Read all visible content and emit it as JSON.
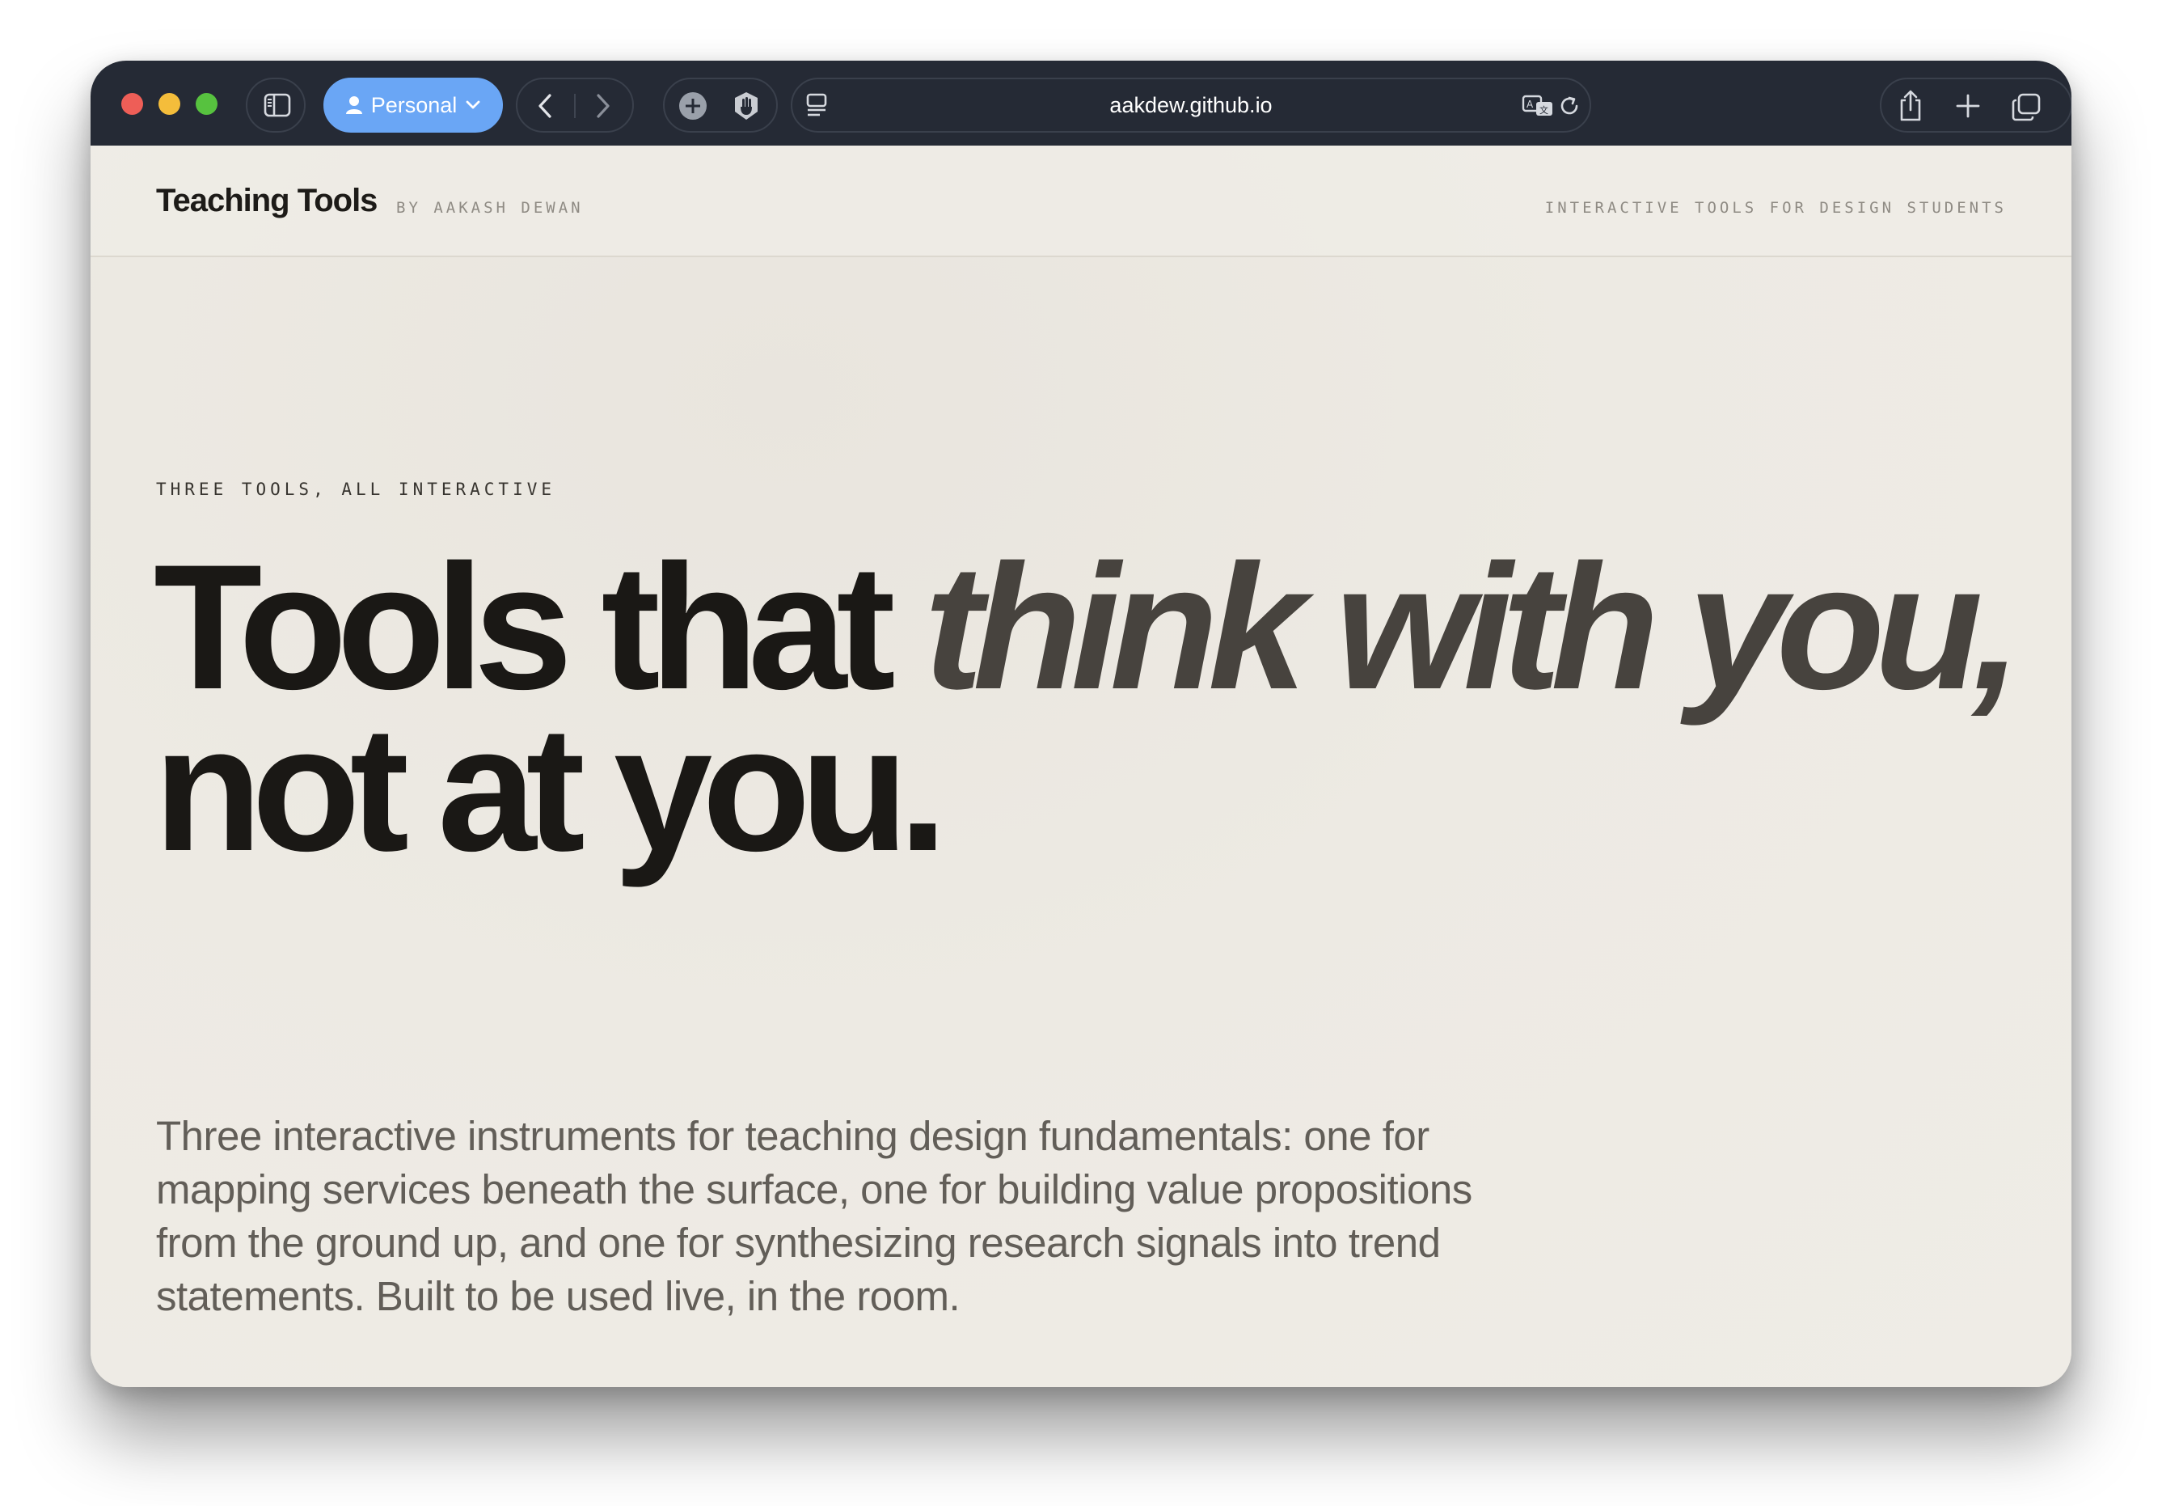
{
  "browser": {
    "profile_label": "Personal",
    "url": "aakdew.github.io"
  },
  "site": {
    "brand": "Teaching Tools",
    "byline": "BY AAKASH DEWAN",
    "tagline": "INTERACTIVE TOOLS FOR DESIGN STUDENTS"
  },
  "hero": {
    "eyebrow": "THREE TOOLS, ALL INTERACTIVE",
    "headline_part1": "Tools that ",
    "headline_em": "think with you,",
    "headline_part2": "not at you.",
    "lede": "Three interactive instruments for teaching design fundamentals: one for mapping services beneath the surface, one for building value propositions from the ground up, and one for synthesizing research signals into trend statements. Built to be used live, in the room."
  },
  "icons": {
    "sidebar": "sidebar-icon",
    "profile": "person-icon",
    "chevron": "chevron-down-icon",
    "back": "chevron-left-icon",
    "forward": "chevron-right-icon",
    "extension_add": "plus-circle-icon",
    "extension_block": "hand-icon",
    "reader": "reader-icon",
    "translate": "translate-icon",
    "reload": "reload-icon",
    "share": "share-icon",
    "new_tab": "plus-icon",
    "tabs": "tab-overview-icon"
  },
  "colors": {
    "toolbar": "#252a35",
    "profile_accent": "#6aa6f5",
    "page_bg": "#efece6",
    "headline": "#1a1815",
    "headline_em": "#47433e",
    "lede": "#625e58",
    "muted_mono": "#8f8b84"
  }
}
